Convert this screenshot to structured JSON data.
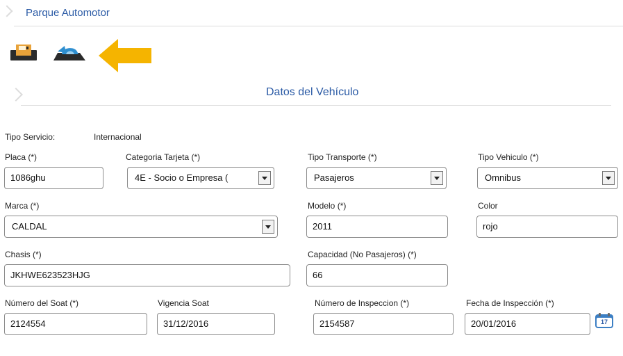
{
  "header": {
    "title": "Parque Automotor"
  },
  "toolbar": {
    "save_icon": "save-icon",
    "undo_icon": "undo-icon",
    "pointer": "arrow-pointer-icon"
  },
  "section": {
    "title": "Datos del Vehículo"
  },
  "form": {
    "tipo_servicio": {
      "label": "Tipo Servicio:",
      "value": "Internacional"
    },
    "placa": {
      "label": "Placa (*)",
      "value": "1086ghu"
    },
    "categoria_tarjeta": {
      "label": "Categoria Tarjeta (*)",
      "value": "4E - Socio o Empresa ("
    },
    "tipo_transporte": {
      "label": "Tipo Transporte (*)",
      "value": "Pasajeros"
    },
    "tipo_vehiculo": {
      "label": "Tipo Vehiculo (*)",
      "value": "Omnibus"
    },
    "marca": {
      "label": "Marca (*)",
      "value": "CALDAL"
    },
    "modelo": {
      "label": "Modelo (*)",
      "value": "2011"
    },
    "color": {
      "label": "Color",
      "value": "rojo"
    },
    "chasis": {
      "label": "Chasis (*)",
      "value": "JKHWE623523HJG"
    },
    "capacidad": {
      "label": "Capacidad (No Pasajeros) (*)",
      "value": "66"
    },
    "numero_soat": {
      "label": "Número del Soat (*)",
      "value": "2124554"
    },
    "vigencia_soat": {
      "label": "Vigencia Soat",
      "value": "31/12/2016"
    },
    "numero_inspeccion": {
      "label": "Número de Inspeccion (*)",
      "value": "2154587"
    },
    "fecha_inspeccion": {
      "label": "Fecha de Inspección (*)",
      "value": "20/01/2016"
    },
    "calendar": {
      "day": "17",
      "icon": "calendar-icon"
    }
  },
  "colors": {
    "title": "#2a5aa5",
    "arrow": "#f5b400",
    "icon_dark": "#2b2b2b",
    "icon_blue": "#2f8fd0"
  }
}
